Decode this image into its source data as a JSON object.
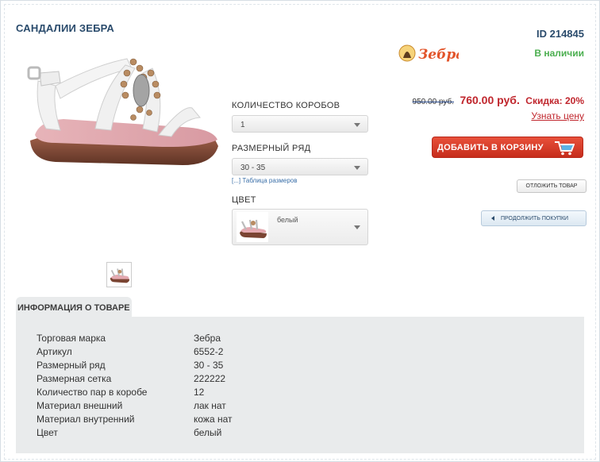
{
  "product": {
    "title": "САНДАЛИИ ЗЕБРА",
    "id_label": "ID 214845",
    "stock": "В наличии",
    "brand_logo_text": "Зебра"
  },
  "options": {
    "qty_label": "КОЛИЧЕСТВО КОРОБОВ",
    "qty_value": "1",
    "size_label": "РАЗМЕРНЫЙ РЯД",
    "size_value": "30 - 35",
    "size_table_link": "[...] Таблица размеров",
    "color_label": "ЦВЕТ",
    "color_value": "белый"
  },
  "price": {
    "old": "950.00 руб.",
    "new": "760.00 руб.",
    "discount": "Скидка: 20%",
    "ask": "Узнать цену"
  },
  "buttons": {
    "add_to_cart": "ДОБАВИТЬ В КОРЗИНУ",
    "defer": "ОТЛОЖИТЬ ТОВАР",
    "continue": "ПРОДОЛЖИТЬ ПОКУПКИ"
  },
  "info": {
    "tab_label": "ИНФОРМАЦИЯ О ТОВАРЕ",
    "rows": [
      {
        "k": "Торговая марка",
        "v": "Зебра"
      },
      {
        "k": "Артикул",
        "v": "6552-2"
      },
      {
        "k": "Размерный ряд",
        "v": "30 - 35"
      },
      {
        "k": "Размерная сетка",
        "v": "222222"
      },
      {
        "k": "Количество пар в коробе",
        "v": "12"
      },
      {
        "k": "Материал внешний",
        "v": "лак нат"
      },
      {
        "k": "Материал внутренний",
        "v": "кожа нат"
      },
      {
        "k": "Цвет",
        "v": "белый"
      }
    ]
  },
  "colors": {
    "title": "#2a4b6c",
    "stock": "#4caf50",
    "price": "#c0262d",
    "cart_button": "#d63b26",
    "info_panel": "#e9ebec"
  },
  "icons": [
    "sandal-photo",
    "sandal-thumbnail-icon",
    "brand-logo",
    "dropdown-arrow-icon",
    "cart-icon",
    "triangle-left-icon"
  ]
}
